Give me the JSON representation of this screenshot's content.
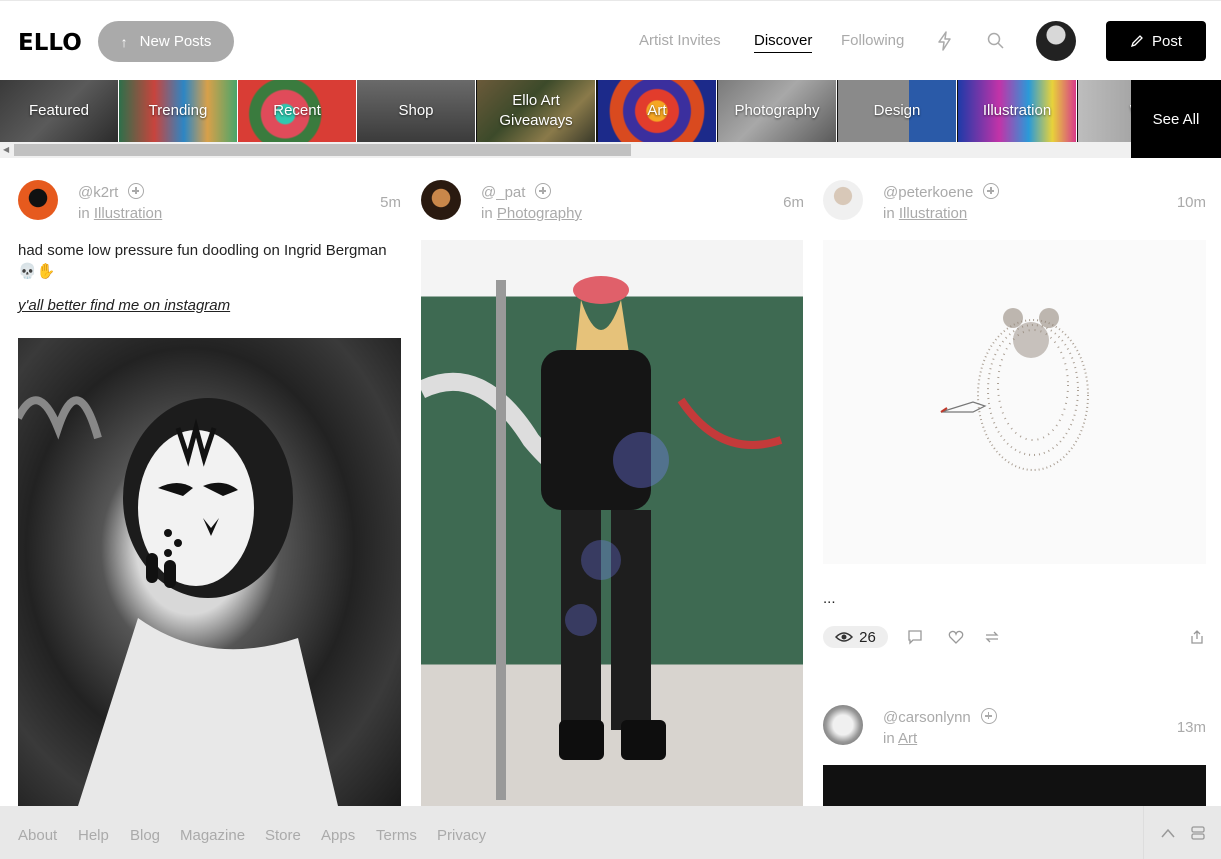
{
  "header": {
    "logo": "ELLO",
    "new_posts_label": "New Posts",
    "nav": [
      "Artist Invites",
      "Discover",
      "Following"
    ],
    "active_nav": "Discover",
    "post_label": "Post"
  },
  "categories": [
    "Featured",
    "Trending",
    "Recent",
    "Shop",
    "Ello Art Giveaways",
    "Art",
    "Photography",
    "Design",
    "Illustration",
    "W"
  ],
  "see_all_label": "See All",
  "posts": [
    {
      "username": "@k2rt",
      "in_label": "in",
      "category": "Illustration",
      "time": "5m",
      "text": "had some low pressure fun doodling on Ingrid Bergman 💀✋",
      "link": "y'all better find me on instagram"
    },
    {
      "username": "@_pat",
      "in_label": "in",
      "category": "Photography",
      "time": "6m"
    },
    {
      "username": "@peterkoene",
      "in_label": "in",
      "category": "Illustration",
      "time": "10m",
      "text": "...",
      "views": "26"
    },
    {
      "username": "@carsonlynn",
      "in_label": "in",
      "category": "Art",
      "time": "13m"
    }
  ],
  "footer": [
    "About",
    "Help",
    "Blog",
    "Magazine",
    "Store",
    "Apps",
    "Terms",
    "Privacy"
  ],
  "icons": [
    "arrow-up-icon",
    "lightning-icon",
    "search-icon",
    "pencil-icon",
    "eye-icon",
    "comment-icon",
    "heart-icon",
    "repost-icon",
    "share-icon",
    "chevron-up-icon",
    "layout-toggle-icon"
  ]
}
